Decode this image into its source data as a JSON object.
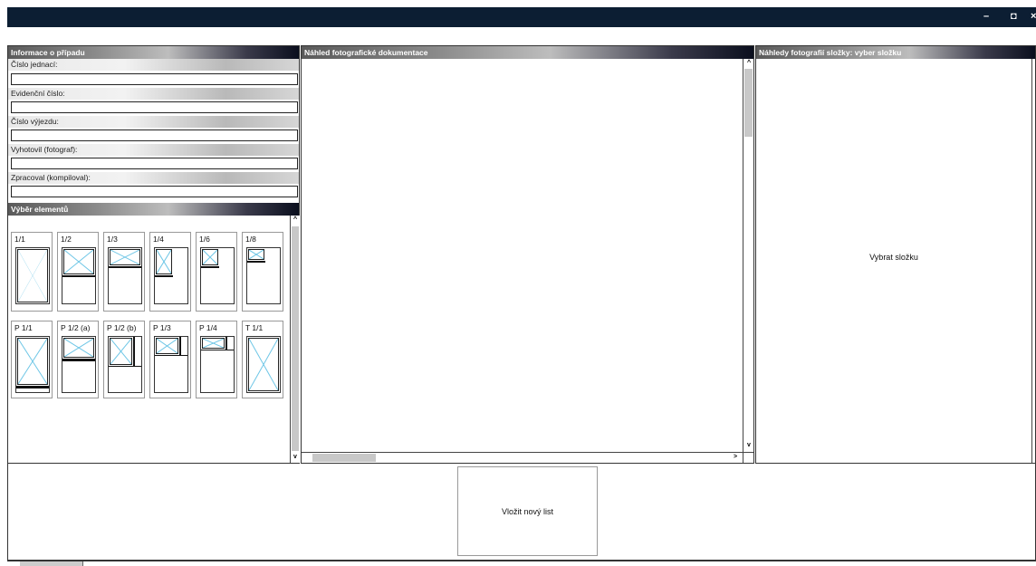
{
  "window": {
    "controls": {
      "minimize": "–",
      "restore": "◘",
      "close": "×"
    }
  },
  "case_info": {
    "header": "Informace o případu",
    "fields": [
      {
        "label": "Číslo jednací:",
        "value": ""
      },
      {
        "label": "Evidenční číslo:",
        "value": ""
      },
      {
        "label": "Číslo výjezdu:",
        "value": ""
      },
      {
        "label": "Vyhotovil (fotograf):",
        "value": ""
      },
      {
        "label": "Zpracoval (kompiloval):",
        "value": ""
      }
    ]
  },
  "elements": {
    "header": "Výběr elementů",
    "tiles_row1": [
      "1/1",
      "1/2",
      "1/3",
      "1/4",
      "1/6",
      "1/8"
    ],
    "tiles_row2": [
      "P 1/1",
      "P 1/2 (a)",
      "P 1/2 (b)",
      "P 1/3",
      "P 1/4",
      "T 1/1"
    ]
  },
  "preview": {
    "header": "Náhled fotografické dokumentace"
  },
  "thumbnails": {
    "header": "Náhledy fotografií složky: vyber složku",
    "select_folder": "Vybrat složku"
  },
  "bottom": {
    "new_sheet": "Vložit nový list"
  },
  "scroll_glyphs": {
    "up": "^",
    "down": "v",
    "left": "<",
    "right": ">"
  },
  "colors": {
    "titlebar": "#0c1e33",
    "placeholder_cross": "#6ec6e6",
    "scroll_thumb": "#c8c8c8"
  }
}
